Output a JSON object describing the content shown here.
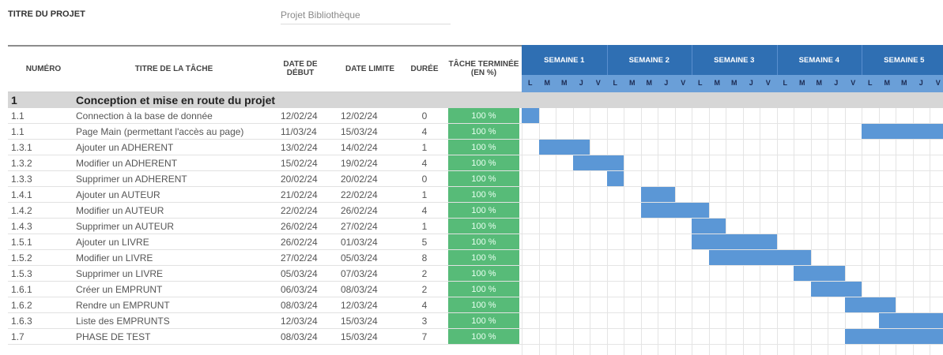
{
  "project": {
    "label": "TITRE DU PROJET",
    "value": "Projet Bibliothèque"
  },
  "headers": {
    "numero": "NUMÉRO",
    "titre": "TITRE DE LA TÂCHE",
    "debut_1": "DATE DE",
    "debut_2": "DÉBUT",
    "limite": "DATE LIMITE",
    "duree": "DURÉE",
    "terminee_1": "TÂCHE TERMINÉE",
    "terminee_2": "(EN %)"
  },
  "weeks": [
    "SEMAINE 1",
    "SEMAINE 2",
    "SEMAINE 3",
    "SEMAINE 4",
    "SEMAINE 5"
  ],
  "days": [
    "L",
    "M",
    "M",
    "J",
    "V"
  ],
  "phase": {
    "num": "1",
    "title": "Conception et mise en route du projet"
  },
  "tasks": [
    {
      "num": "1.1",
      "title": "Connection à la base de donnée",
      "start": "12/02/24",
      "end": "12/02/24",
      "duration": "0",
      "pct": "100 %",
      "bar_start": 0,
      "bar_len": 1
    },
    {
      "num": "1.1",
      "title": "Page Main (permettant l'accès au page)",
      "start": "11/03/24",
      "end": "15/03/24",
      "duration": "4",
      "pct": "100 %",
      "bar_start": 20,
      "bar_len": 5
    },
    {
      "num": "1.3.1",
      "title": "Ajouter un ADHERENT",
      "start": "13/02/24",
      "end": "14/02/24",
      "duration": "1",
      "pct": "100 %",
      "bar_start": 1,
      "bar_len": 3
    },
    {
      "num": "1.3.2",
      "title": "Modifier un ADHERENT",
      "start": "15/02/24",
      "end": "19/02/24",
      "duration": "4",
      "pct": "100 %",
      "bar_start": 3,
      "bar_len": 3
    },
    {
      "num": "1.3.3",
      "title": "Supprimer un ADHERENT",
      "start": "20/02/24",
      "end": "20/02/24",
      "duration": "0",
      "pct": "100 %",
      "bar_start": 5,
      "bar_len": 1
    },
    {
      "num": "1.4.1",
      "title": "Ajouter un AUTEUR",
      "start": "21/02/24",
      "end": "22/02/24",
      "duration": "1",
      "pct": "100 %",
      "bar_start": 7,
      "bar_len": 2
    },
    {
      "num": "1.4.2",
      "title": "Modifier un AUTEUR",
      "start": "22/02/24",
      "end": "26/02/24",
      "duration": "4",
      "pct": "100 %",
      "bar_start": 7,
      "bar_len": 4
    },
    {
      "num": "1.4.3",
      "title": "Supprimer un AUTEUR",
      "start": "26/02/24",
      "end": "27/02/24",
      "duration": "1",
      "pct": "100 %",
      "bar_start": 10,
      "bar_len": 2
    },
    {
      "num": "1.5.1",
      "title": "Ajouter un LIVRE",
      "start": "26/02/24",
      "end": "01/03/24",
      "duration": "5",
      "pct": "100 %",
      "bar_start": 10,
      "bar_len": 5
    },
    {
      "num": "1.5.2",
      "title": "Modifier un LIVRE",
      "start": "27/02/24",
      "end": "05/03/24",
      "duration": "8",
      "pct": "100 %",
      "bar_start": 11,
      "bar_len": 6
    },
    {
      "num": "1.5.3",
      "title": "Supprimer un LIVRE",
      "start": "05/03/24",
      "end": "07/03/24",
      "duration": "2",
      "pct": "100 %",
      "bar_start": 16,
      "bar_len": 3
    },
    {
      "num": "1.6.1",
      "title": "Créer un EMPRUNT",
      "start": "06/03/24",
      "end": "08/03/24",
      "duration": "2",
      "pct": "100 %",
      "bar_start": 17,
      "bar_len": 3
    },
    {
      "num": "1.6.2",
      "title": "Rendre un EMPRUNT",
      "start": "08/03/24",
      "end": "12/03/24",
      "duration": "4",
      "pct": "100 %",
      "bar_start": 19,
      "bar_len": 3
    },
    {
      "num": "1.6.3",
      "title": "Liste des EMPRUNTS",
      "start": "12/03/24",
      "end": "15/03/24",
      "duration": "3",
      "pct": "100 %",
      "bar_start": 21,
      "bar_len": 4
    },
    {
      "num": "1.7",
      "title": "PHASE DE TEST",
      "start": "08/03/24",
      "end": "15/03/24",
      "duration": "7",
      "pct": "100 %",
      "bar_start": 19,
      "bar_len": 6
    }
  ],
  "colors": {
    "week_header": "#2f6fb3",
    "day_header": "#6a9fd8",
    "bar": "#5b97d6",
    "complete": "#57bb78",
    "phase_row": "#d6d6d6"
  }
}
